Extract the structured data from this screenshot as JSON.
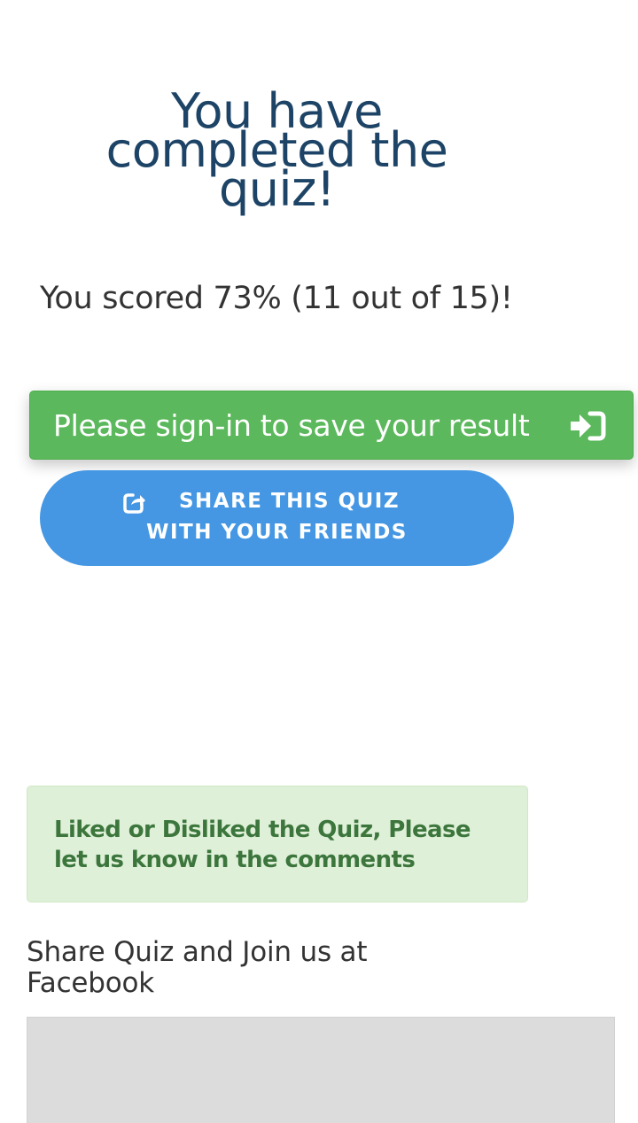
{
  "result": {
    "title": "You have completed the quiz!",
    "score_text": "You scored 73% (11 out of 15)!"
  },
  "actions": {
    "signin_label": "Please sign-in to save your result",
    "signin_icon": "sign-in-icon",
    "share_label": "SHARE THIS QUIZ WITH YOUR FRIENDS",
    "share_icon": "external-share-icon"
  },
  "feedback": {
    "alert_text": "Liked or Disliked the Quiz, Please let us know in the comments"
  },
  "facebook": {
    "heading": "Share Quiz and Join us at Facebook"
  },
  "colors": {
    "title": "#1d4466",
    "signin_bg": "#5cb85c",
    "share_bg": "#4597e3",
    "alert_bg": "#dff0d8",
    "alert_text": "#3c763d",
    "placeholder_bg": "#dcdcdc"
  }
}
